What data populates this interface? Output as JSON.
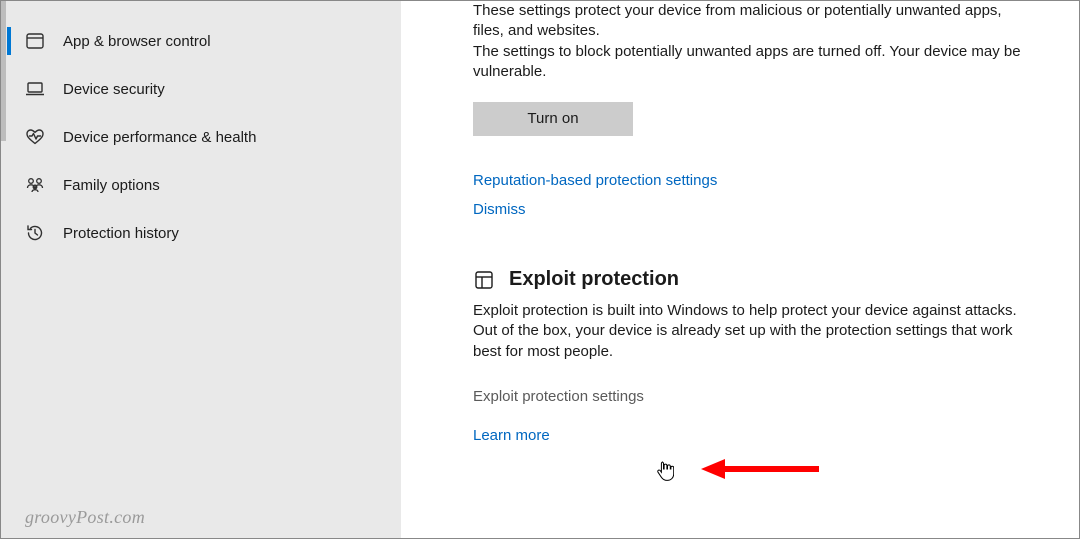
{
  "sidebar": {
    "items": [
      {
        "label": "App & browser control",
        "selected": true,
        "icon": "browser-icon"
      },
      {
        "label": "Device security",
        "selected": false,
        "icon": "laptop-icon"
      },
      {
        "label": "Device performance & health",
        "selected": false,
        "icon": "health-icon"
      },
      {
        "label": "Family options",
        "selected": false,
        "icon": "family-icon"
      },
      {
        "label": "Protection history",
        "selected": false,
        "icon": "history-icon"
      }
    ]
  },
  "main": {
    "reputation": {
      "desc1": "These settings protect your device from malicious or potentially unwanted apps, files, and websites.",
      "desc2": "The settings to block potentially unwanted apps are turned off. Your device may be vulnerable.",
      "turn_on_label": "Turn on",
      "settings_link": "Reputation-based protection settings",
      "dismiss_link": "Dismiss"
    },
    "exploit": {
      "title": "Exploit protection",
      "desc": "Exploit protection is built into Windows to help protect your device against attacks.  Out of the box, your device is already set up with the protection settings that work best for most people.",
      "settings_link": "Exploit protection settings",
      "learn_more_link": "Learn more"
    }
  },
  "watermark": "groovyPost.com"
}
